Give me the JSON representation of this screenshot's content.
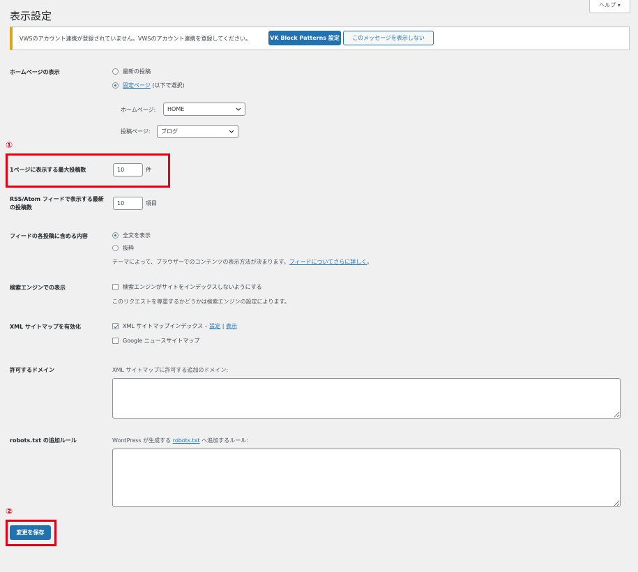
{
  "page": {
    "title": "表示設定",
    "help_label": "ヘルプ ▾"
  },
  "notice": {
    "text": "VWSのアカウント連携が登録されていません。VWSのアカウント連携を登録してください。",
    "primary_button": "VK Block Patterns 設定",
    "secondary_button": "このメッセージを表示しない"
  },
  "homepage": {
    "label": "ホームページの表示",
    "option_latest": "最新の投稿",
    "option_static_link": "固定ページ",
    "option_static_suffix": " (以下で選択)",
    "front_page_label": "ホームページ:",
    "front_page_value": "HOME",
    "posts_page_label": "投稿ページ:",
    "posts_page_value": "ブログ"
  },
  "annotations": {
    "marker1": "①",
    "marker2": "②"
  },
  "posts_per_page": {
    "label": "1ページに表示する最大投稿数",
    "value": "10",
    "unit": "件"
  },
  "rss": {
    "label": "RSS/Atom フィードで表示する最新の投稿数",
    "value": "10",
    "unit": "項目"
  },
  "feed_content": {
    "label": "フィードの各投稿に含める内容",
    "option_full": "全文を表示",
    "option_excerpt": "抜粋",
    "desc_prefix": "テーマによって、ブラウザーでのコンテンツの表示方法が決まります。",
    "desc_link": "フィードについてさらに詳しく",
    "desc_suffix": "。"
  },
  "search_engine": {
    "label": "検索エンジンでの表示",
    "checkbox_label": "検索エンジンがサイトをインデックスしないようにする",
    "desc": "このリクエストを尊重するかどうかは検索エンジンの設定によります。"
  },
  "xml_sitemap": {
    "label": "XML サイトマップを有効化",
    "index_label": "XML サイトマップインデックス –",
    "settings_link": "設定",
    "separator": "|",
    "view_link": "表示",
    "google_news_label": "Google ニュースサイトマップ"
  },
  "allowed_domains": {
    "label": "許可するドメイン",
    "desc": "XML サイトマップに許可する追加のドメイン:"
  },
  "robots": {
    "label": "robots.txt の追加ルール",
    "desc_prefix": "WordPress が生成する ",
    "desc_link": "robots.txt",
    "desc_suffix": " へ追加するルール:"
  },
  "save_button": "変更を保存",
  "colors": {
    "accent": "#2271b1",
    "notice_warning": "#dba617",
    "annotation_red": "#e50012"
  }
}
